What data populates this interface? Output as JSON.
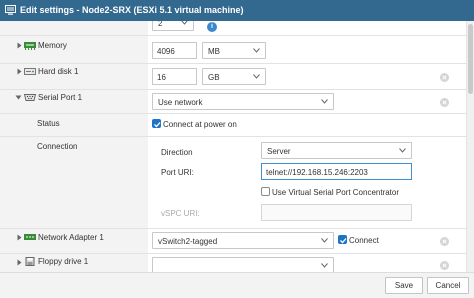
{
  "window": {
    "title": "Edit settings - Node2-SRX (ESXi 5.1 virtual machine)"
  },
  "hardware": {
    "cpu_count_value": "2",
    "memory": {
      "label": "Memory",
      "value": "4096",
      "unit": "MB"
    },
    "hard_disk": {
      "label": "Hard disk 1",
      "value": "16",
      "unit": "GB"
    },
    "serial_port": {
      "label": "Serial Port 1",
      "type_value": "Use network",
      "status_label": "Status",
      "connect_at_power_on_label": "Connect at power on",
      "connect_at_power_on_checked": true,
      "connection_label": "Connection",
      "direction_label": "Direction",
      "direction_value": "Server",
      "port_uri_label": "Port URI:",
      "port_uri_value": "telnet://192.168.15.246:2203",
      "vspc_checkbox_label": "Use Virtual Serial Port Concentrator",
      "vspc_checked": false,
      "vspc_uri_label": "vSPC URI:",
      "vspc_uri_value": ""
    },
    "network_adapter": {
      "label": "Network Adapter 1",
      "network_value": "vSwitch2-tagged",
      "connect_label": "Connect",
      "connect_checked": true
    },
    "floppy": {
      "label": "Floppy drive 1",
      "value": ""
    }
  },
  "footer": {
    "save_label": "Save",
    "cancel_label": "Cancel"
  },
  "colors": {
    "titlebar": "#33688f",
    "checkbox_on": "#1f73c4",
    "focus_border": "#3f8fd2",
    "icon_green": "#3b8a3b"
  },
  "icons": {
    "memory": "memory-chip-icon",
    "hard_disk": "hard-disk-icon",
    "serial_port": "serial-port-icon",
    "network_adapter": "network-adapter-icon",
    "floppy": "floppy-drive-icon"
  }
}
